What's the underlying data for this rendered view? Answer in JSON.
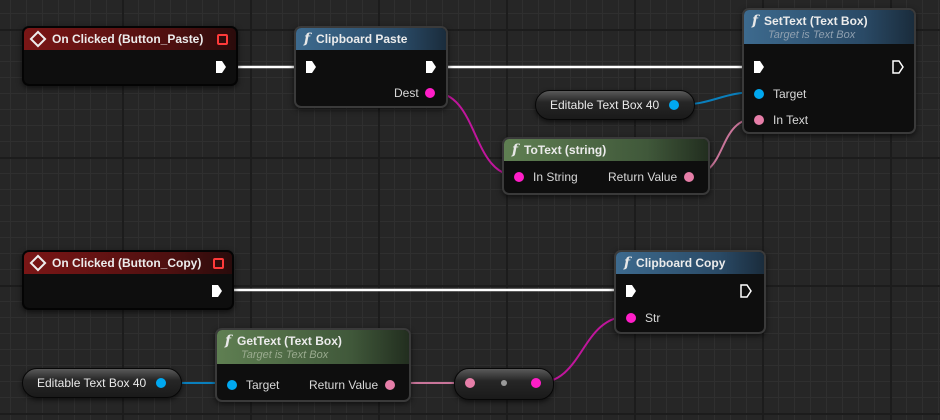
{
  "nodes": {
    "on_clicked_paste": {
      "title": "On Clicked (Button_Paste)"
    },
    "clipboard_paste": {
      "title": "Clipboard Paste",
      "dest": "Dest"
    },
    "set_text": {
      "title": "SetText (Text Box)",
      "subtitle": "Target is Text Box",
      "target": "Target",
      "in_text": "In Text"
    },
    "var_textbox_top": {
      "label": "Editable Text Box 40"
    },
    "to_text": {
      "title": "ToText (string)",
      "in_string": "In String",
      "return_value": "Return Value"
    },
    "on_clicked_copy": {
      "title": "On Clicked (Button_Copy)"
    },
    "clipboard_copy": {
      "title": "Clipboard Copy",
      "str": "Str"
    },
    "get_text": {
      "title": "GetText (Text Box)",
      "subtitle": "Target is Text Box",
      "target": "Target",
      "return_value": "Return Value"
    },
    "var_textbox_bottom": {
      "label": "Editable Text Box 40"
    }
  },
  "colors": {
    "exec": "#ffffff",
    "object_pin": "#00a8f0",
    "string_pin": "#ff1ec8",
    "text_pin": "#e67ea8",
    "event_header": "#7a1616",
    "function_header": "#3d6a8e",
    "pure_header": "#5f7f52"
  },
  "icons": {
    "function": "f",
    "event": "diamond-icon",
    "exec": "exec-arrow-icon"
  }
}
